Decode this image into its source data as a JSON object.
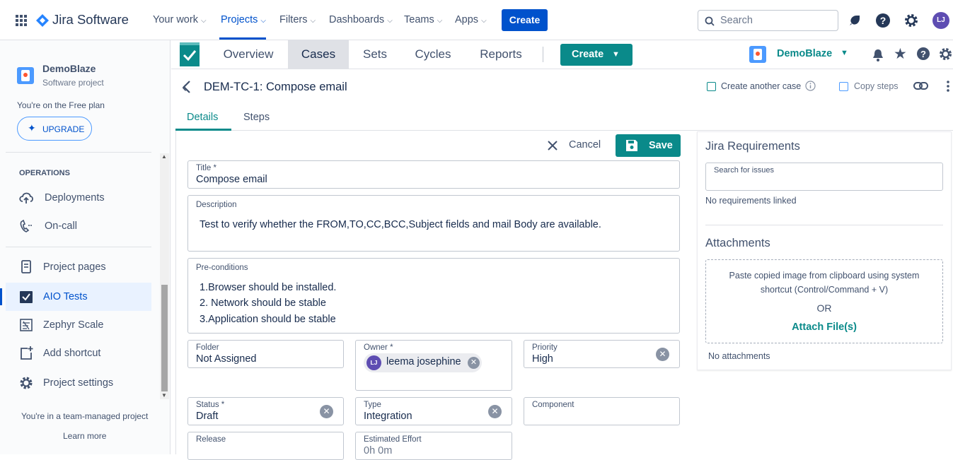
{
  "topnav": {
    "logo": "Jira Software",
    "items": [
      {
        "label": "Your work"
      },
      {
        "label": "Projects"
      },
      {
        "label": "Filters"
      },
      {
        "label": "Dashboards"
      },
      {
        "label": "Teams"
      },
      {
        "label": "Apps"
      }
    ],
    "create": "Create",
    "search_placeholder": "Search",
    "avatar_initials": "LJ",
    "accent": "#0052cc"
  },
  "sidebar": {
    "project_name": "DemoBlaze",
    "project_type": "Software project",
    "plan": "You're on the Free plan",
    "upgrade": "UPGRADE",
    "section_title": "OPERATIONS",
    "ops_items": [
      {
        "label": "Deployments",
        "icon": "cloud-upload-icon"
      },
      {
        "label": "On-call",
        "icon": "phone-icon"
      }
    ],
    "items": [
      {
        "label": "Project pages",
        "icon": "page-icon"
      },
      {
        "label": "AIO Tests",
        "icon": "aio-tests-icon"
      },
      {
        "label": "Zephyr Scale",
        "icon": "zephyr-icon"
      },
      {
        "label": "Add shortcut",
        "icon": "add-shortcut-icon"
      },
      {
        "label": "Project settings",
        "icon": "gear-icon"
      }
    ],
    "footer": "You're in a team-managed project",
    "learn_more": "Learn more"
  },
  "project_tabs": {
    "tabs": [
      {
        "label": "Overview"
      },
      {
        "label": "Cases"
      },
      {
        "label": "Sets"
      },
      {
        "label": "Cycles"
      },
      {
        "label": "Reports"
      }
    ],
    "create": "Create",
    "project": "DemoBlaze",
    "accent": "#0a8a8a"
  },
  "case": {
    "title": "DEM-TC-1: Compose email",
    "create_another": "Create another case",
    "copy_steps": "Copy steps",
    "tabs": [
      {
        "label": "Details"
      },
      {
        "label": "Steps"
      }
    ],
    "cancel": "Cancel",
    "save": "Save"
  },
  "form": {
    "title_label": "Title *",
    "title_value": "Compose email",
    "description_label": "Description",
    "description_value": "Test to verify whether the FROM,TO,CC,BCC,Subject fields and mail Body are available.",
    "preconditions_label": "Pre-conditions",
    "preconditions_lines": [
      "1.Browser should be installed.",
      "2. Network should be stable",
      "3.Application should be stable"
    ],
    "folder_label": "Folder",
    "folder_value": "Not Assigned",
    "owner_label": "Owner *",
    "owner_value": "leema josephine",
    "owner_initials": "LJ",
    "priority_label": "Priority",
    "priority_value": "High",
    "status_label": "Status *",
    "status_value": "Draft",
    "type_label": "Type",
    "type_value": "Integration",
    "component_label": "Component",
    "component_value": "",
    "release_label": "Release",
    "release_value": "",
    "effort_label": "Estimated Effort",
    "effort_value": "0h 0m"
  },
  "right_panel": {
    "requirements_title": "Jira Requirements",
    "search_label": "Search for issues",
    "no_requirements": "No requirements linked",
    "attachments_title": "Attachments",
    "paste_hint_1": "Paste copied image from clipboard using system",
    "paste_hint_2": "shortcut (Control/Command + V)",
    "or": "OR",
    "attach": "Attach File(s)",
    "no_attachments": "No attachments"
  }
}
